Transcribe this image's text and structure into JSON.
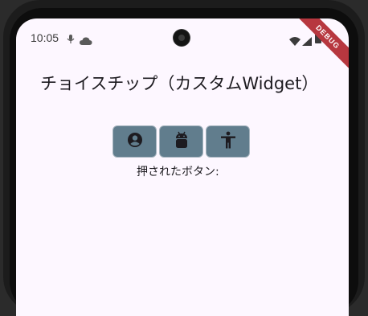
{
  "status_bar": {
    "time": "10:05",
    "icons": [
      "mic-icon",
      "cloud-icon",
      "wifi-icon",
      "signal-icon",
      "battery-icon"
    ]
  },
  "app": {
    "title": "チョイスチップ（カスタムWidget）",
    "chips": [
      {
        "icon": "account-circle-icon"
      },
      {
        "icon": "android-icon"
      },
      {
        "icon": "accessibility-icon"
      }
    ],
    "pressed_label": "押されたボタン:"
  },
  "debug_banner": "DEBUG",
  "colors": {
    "chip_bg": "#617d8d",
    "chip_border": "#a6b4be",
    "icon": "#1d1b20",
    "background": "#fdf7ff",
    "debug_banner": "#b7373f"
  }
}
